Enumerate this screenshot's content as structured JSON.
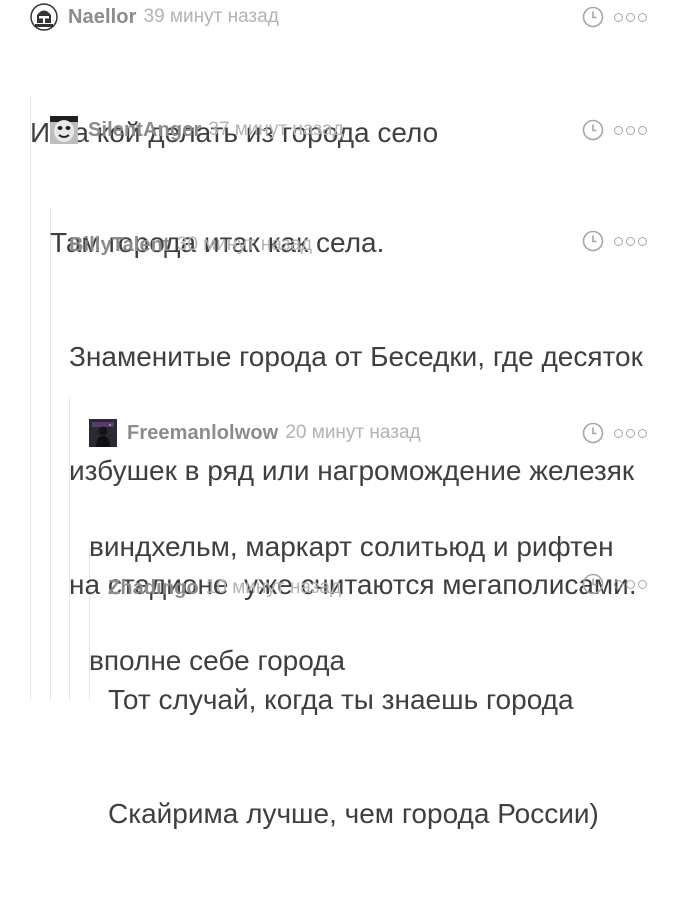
{
  "comments": [
    {
      "username": "Naellor",
      "time": "39 минут назад",
      "lines": [
        "И на кой делать из города село"
      ],
      "avatar_icon": "knight-helmet-icon"
    },
    {
      "username": "SilentAnger",
      "time": "37 минут назад",
      "lines": [
        "Там города итак как села."
      ],
      "avatar_icon": "masked-face-icon"
    },
    {
      "username": "BillyTalent",
      "time": "30 минут назад",
      "lines": [
        "Знаменитые города от Беседки, где десяток",
        "избушек в ряд или нагромождение железяк",
        "на стадионе  уже считаются мегаполисами."
      ]
    },
    {
      "username": "Freemanlolwow",
      "time": "20 минут назад",
      "lines": [
        "виндхельм, маркарт солитьюд и рифтен",
        "вполне себе города"
      ],
      "avatar_icon": "dark-figure-icon"
    },
    {
      "username": "Zhadingo",
      "time": "10 минут назад",
      "lines": [
        "Тот случай, когда ты знаешь города",
        "Скайрима лучше, чем города России)"
      ]
    }
  ],
  "colors": {
    "thread_line": "#e6e6e6",
    "username": "#8c8c8c",
    "time": "#b3b3b3",
    "text": "#3f3f3f",
    "icon": "#a6a6a6"
  }
}
